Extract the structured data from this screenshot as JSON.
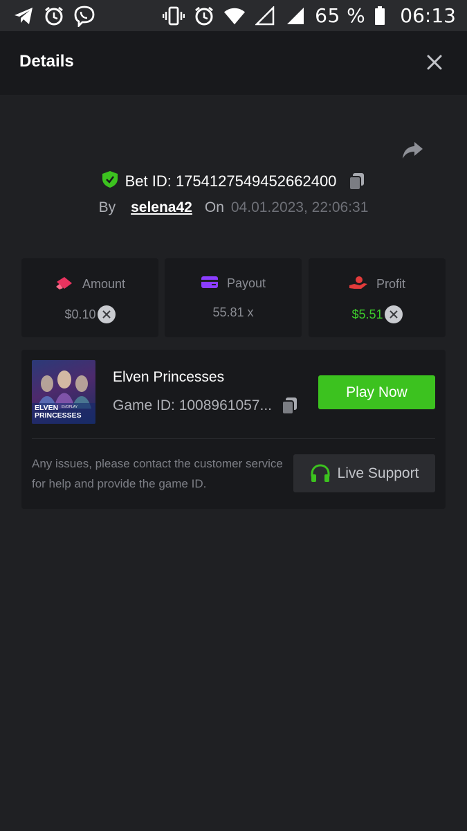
{
  "status_bar": {
    "battery": "65 %",
    "time": "06:13",
    "icons_left": [
      "telegram-icon",
      "alarm-icon",
      "viber-icon"
    ],
    "icons_right": [
      "vibrate-icon",
      "alarm-icon",
      "wifi-icon",
      "signal-empty-icon",
      "signal-icon",
      "battery-icon"
    ]
  },
  "header": {
    "title": "Details"
  },
  "bet": {
    "id_text": "Bet ID: 1754127549452662400",
    "by_label": "By",
    "user": "selena42",
    "on_label": "On",
    "date": "04.01.2023, 22:06:31"
  },
  "stats": {
    "amount": {
      "label": "Amount",
      "value": "$0.10"
    },
    "payout": {
      "label": "Payout",
      "value": "55.81 x"
    },
    "profit": {
      "label": "Profit",
      "value": "$5.51"
    }
  },
  "game": {
    "name": "Elven Princesses",
    "id_text": "Game ID: 1008961057...",
    "play_label": "Play Now",
    "thumb_title": "ELVEN PRINCESSES",
    "thumb_brand": "EVOPLAY",
    "issue_text": "Any issues, please contact the customer service for help and provide the game ID.",
    "support_label": "Live Support"
  },
  "colors": {
    "background": "#1f2023",
    "card": "#18191c",
    "accent_green": "#3cc21f",
    "profit_green": "#3ccb2b",
    "amount_icon": "#e8335f",
    "payout_icon": "#8b3dff",
    "profit_icon": "#e23b3b"
  }
}
